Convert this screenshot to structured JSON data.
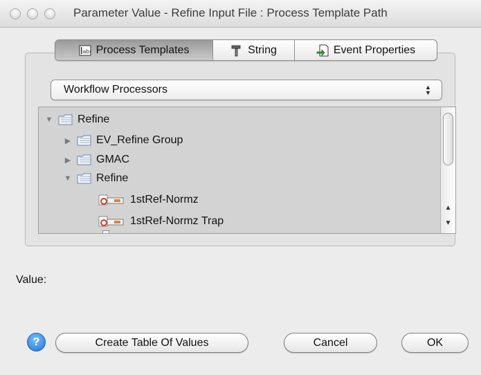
{
  "window": {
    "title": "Parameter Value - Refine Input File : Process Template Path"
  },
  "tabs": [
    {
      "label": "Process Templates",
      "icon": "abc-field-icon",
      "selected": true
    },
    {
      "label": "String",
      "icon": "hammer-icon",
      "selected": false
    },
    {
      "label": "Event Properties",
      "icon": "document-arrow-icon",
      "selected": false
    }
  ],
  "select": {
    "value": "Workflow Processors"
  },
  "tree": {
    "items": [
      {
        "label": "Refine",
        "type": "folder",
        "expanded": true
      },
      {
        "label": "EV_Refine Group",
        "type": "folder",
        "expanded": false
      },
      {
        "label": "GMAC",
        "type": "folder",
        "expanded": false
      },
      {
        "label": "Refine",
        "type": "folder",
        "expanded": true
      },
      {
        "label": "1stRef-Normz",
        "type": "processor"
      },
      {
        "label": "1stRef-Normz Trap",
        "type": "processor"
      }
    ]
  },
  "value": {
    "label": "Value:"
  },
  "buttons": {
    "help": "?",
    "create_table": "Create Table Of Values",
    "cancel": "Cancel",
    "ok": "OK"
  }
}
